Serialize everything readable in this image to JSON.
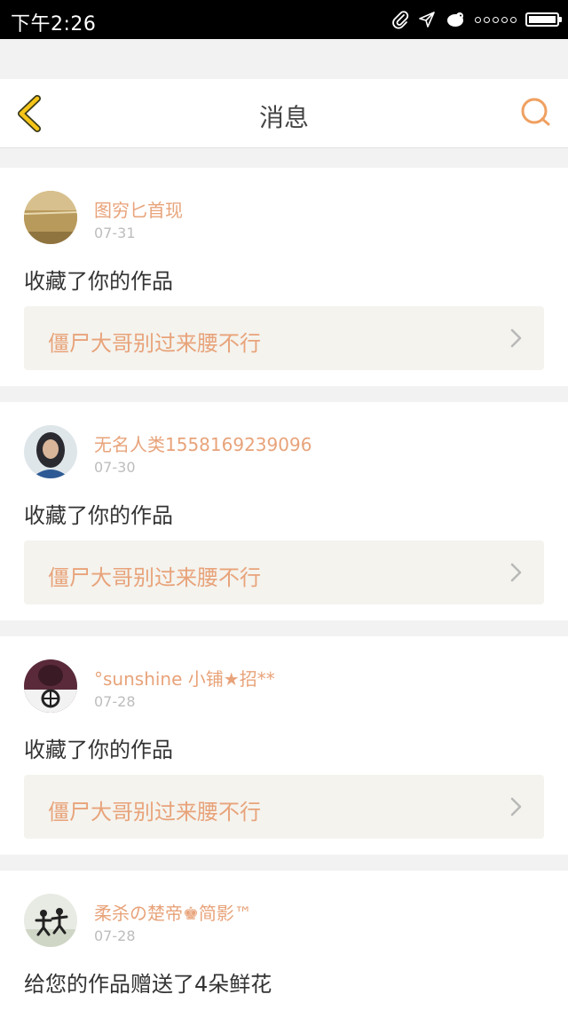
{
  "status_bar": {
    "time": "下午2:26",
    "icons": [
      "paperclip-icon",
      "send-icon",
      "bird-icon",
      "signal-dots-icon",
      "battery-icon"
    ]
  },
  "header": {
    "title": "消息",
    "back_icon": "chevron-left-icon",
    "search_icon": "search-icon",
    "accent_color": "#e8a37a",
    "back_color": "#f5c518"
  },
  "messages": [
    {
      "username": "图穷匕首现",
      "date": "07-31",
      "action": "收藏了你的作品",
      "work_title": "僵尸大哥别过来腰不行"
    },
    {
      "username": "无名人类1558169239096",
      "date": "07-30",
      "action": "收藏了你的作品",
      "work_title": "僵尸大哥别过来腰不行"
    },
    {
      "username": "°sunshine 小铺★招**",
      "date": "07-28",
      "action": "收藏了你的作品",
      "work_title": "僵尸大哥别过来腰不行"
    },
    {
      "username": "柔杀の楚帝♚简影™",
      "date": "07-28",
      "action": "给您的作品赠送了4朵鲜花"
    }
  ]
}
